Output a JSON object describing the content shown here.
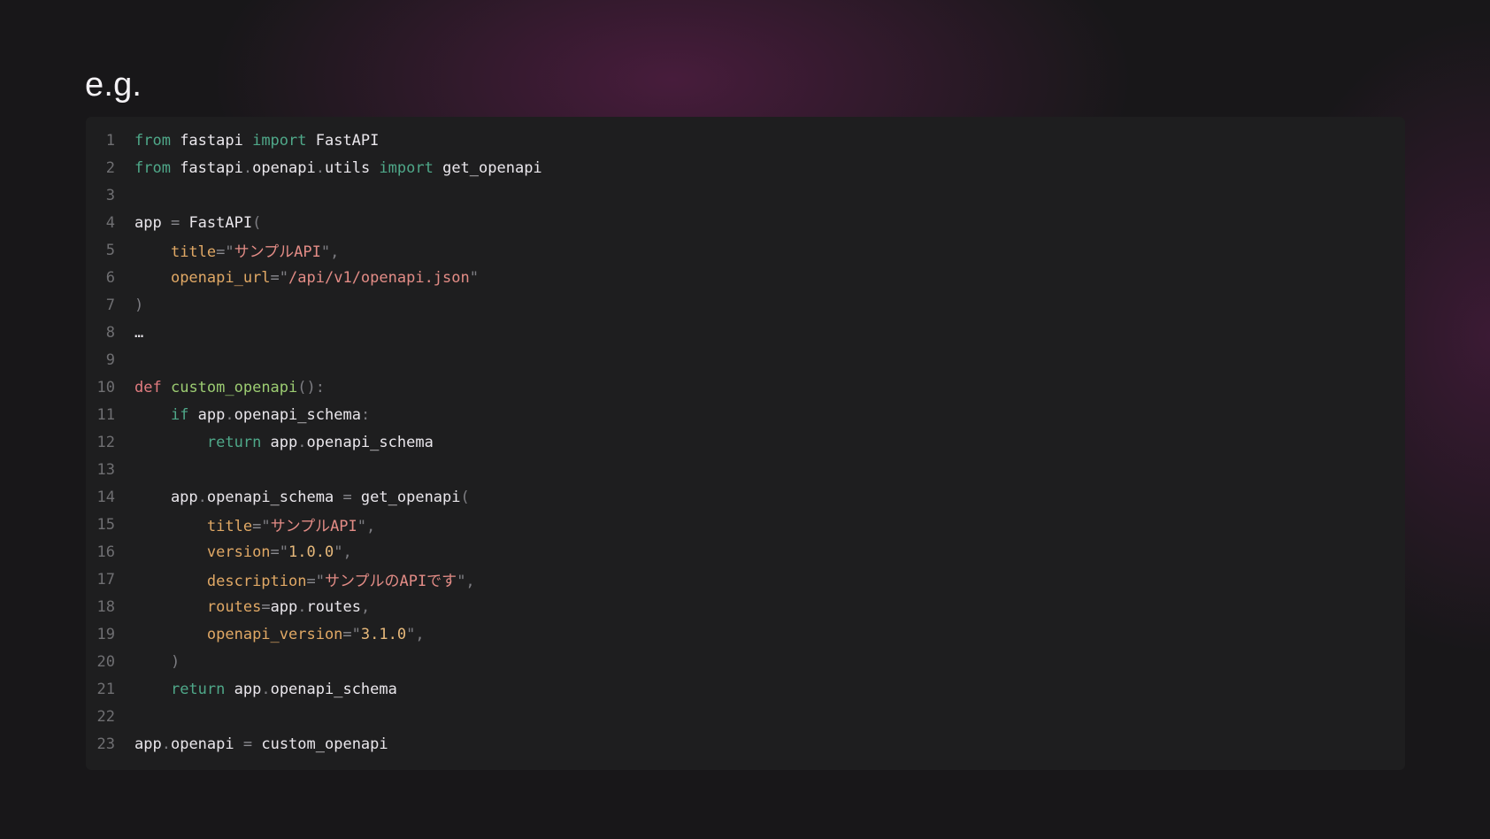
{
  "title": "e.g.",
  "code": {
    "lines": [
      {
        "n": "1",
        "tokens": [
          [
            "kw",
            "from"
          ],
          [
            "id",
            " fastapi "
          ],
          [
            "kw",
            "import"
          ],
          [
            "id",
            " FastAPI"
          ]
        ]
      },
      {
        "n": "2",
        "tokens": [
          [
            "kw",
            "from"
          ],
          [
            "id",
            " fastapi"
          ],
          [
            "punc",
            "."
          ],
          [
            "id",
            "openapi"
          ],
          [
            "punc",
            "."
          ],
          [
            "id",
            "utils "
          ],
          [
            "kw",
            "import"
          ],
          [
            "id",
            " get_openapi"
          ]
        ]
      },
      {
        "n": "3",
        "tokens": []
      },
      {
        "n": "4",
        "tokens": [
          [
            "id",
            "app "
          ],
          [
            "op",
            "="
          ],
          [
            "id",
            " FastAPI"
          ],
          [
            "punc",
            "("
          ]
        ]
      },
      {
        "n": "5",
        "tokens": [
          [
            "id",
            "    "
          ],
          [
            "param",
            "title"
          ],
          [
            "op",
            "="
          ],
          [
            "punc",
            "\""
          ],
          [
            "str",
            "サンプルAPI"
          ],
          [
            "punc",
            "\","
          ]
        ]
      },
      {
        "n": "6",
        "tokens": [
          [
            "id",
            "    "
          ],
          [
            "param",
            "openapi_url"
          ],
          [
            "op",
            "="
          ],
          [
            "punc",
            "\""
          ],
          [
            "str",
            "/api/v1/openapi.json"
          ],
          [
            "punc",
            "\""
          ]
        ]
      },
      {
        "n": "7",
        "tokens": [
          [
            "punc",
            ")"
          ]
        ]
      },
      {
        "n": "8",
        "tokens": [
          [
            "id",
            "…"
          ]
        ]
      },
      {
        "n": "9",
        "tokens": []
      },
      {
        "n": "10",
        "tokens": [
          [
            "def",
            "def"
          ],
          [
            "id",
            " "
          ],
          [
            "fn",
            "custom_openapi"
          ],
          [
            "punc",
            "():"
          ]
        ]
      },
      {
        "n": "11",
        "tokens": [
          [
            "id",
            "    "
          ],
          [
            "kw",
            "if"
          ],
          [
            "id",
            " app"
          ],
          [
            "punc",
            "."
          ],
          [
            "id",
            "openapi_schema"
          ],
          [
            "punc",
            ":"
          ]
        ]
      },
      {
        "n": "12",
        "tokens": [
          [
            "id",
            "        "
          ],
          [
            "kw",
            "return"
          ],
          [
            "id",
            " app"
          ],
          [
            "punc",
            "."
          ],
          [
            "id",
            "openapi_schema"
          ]
        ]
      },
      {
        "n": "13",
        "tokens": []
      },
      {
        "n": "14",
        "tokens": [
          [
            "id",
            "    app"
          ],
          [
            "punc",
            "."
          ],
          [
            "id",
            "openapi_schema "
          ],
          [
            "op",
            "="
          ],
          [
            "id",
            " get_openapi"
          ],
          [
            "punc",
            "("
          ]
        ]
      },
      {
        "n": "15",
        "tokens": [
          [
            "id",
            "        "
          ],
          [
            "param",
            "title"
          ],
          [
            "op",
            "="
          ],
          [
            "punc",
            "\""
          ],
          [
            "str",
            "サンプルAPI"
          ],
          [
            "punc",
            "\","
          ]
        ]
      },
      {
        "n": "16",
        "tokens": [
          [
            "id",
            "        "
          ],
          [
            "param",
            "version"
          ],
          [
            "op",
            "="
          ],
          [
            "punc",
            "\""
          ],
          [
            "num",
            "1.0.0"
          ],
          [
            "punc",
            "\","
          ]
        ]
      },
      {
        "n": "17",
        "tokens": [
          [
            "id",
            "        "
          ],
          [
            "param",
            "description"
          ],
          [
            "op",
            "="
          ],
          [
            "punc",
            "\""
          ],
          [
            "str",
            "サンプルのAPIです"
          ],
          [
            "punc",
            "\","
          ]
        ]
      },
      {
        "n": "18",
        "tokens": [
          [
            "id",
            "        "
          ],
          [
            "param",
            "routes"
          ],
          [
            "op",
            "="
          ],
          [
            "id",
            "app"
          ],
          [
            "punc",
            "."
          ],
          [
            "id",
            "routes"
          ],
          [
            "punc",
            ","
          ]
        ]
      },
      {
        "n": "19",
        "tokens": [
          [
            "id",
            "        "
          ],
          [
            "param",
            "openapi_version"
          ],
          [
            "op",
            "="
          ],
          [
            "punc",
            "\""
          ],
          [
            "num",
            "3.1.0"
          ],
          [
            "punc",
            "\","
          ]
        ]
      },
      {
        "n": "20",
        "tokens": [
          [
            "id",
            "    "
          ],
          [
            "punc",
            ")"
          ]
        ]
      },
      {
        "n": "21",
        "tokens": [
          [
            "id",
            "    "
          ],
          [
            "kw",
            "return"
          ],
          [
            "id",
            " app"
          ],
          [
            "punc",
            "."
          ],
          [
            "id",
            "openapi_schema"
          ]
        ]
      },
      {
        "n": "22",
        "tokens": []
      },
      {
        "n": "23",
        "tokens": [
          [
            "id",
            "app"
          ],
          [
            "punc",
            "."
          ],
          [
            "id",
            "openapi "
          ],
          [
            "op",
            "="
          ],
          [
            "id",
            " custom_openapi"
          ]
        ]
      }
    ]
  }
}
